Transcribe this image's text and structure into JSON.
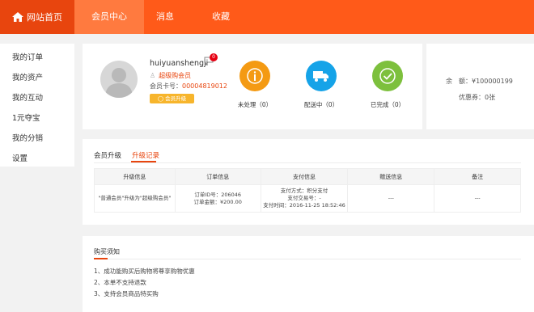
{
  "nav": {
    "home": "网站首页",
    "member_center": "会员中心",
    "messages": "消息",
    "favorites": "收藏"
  },
  "sidebar": {
    "items": [
      {
        "label": "我的订单"
      },
      {
        "label": "我的资产"
      },
      {
        "label": "我的互动"
      },
      {
        "label": "1元夺宝"
      },
      {
        "label": "我的分销"
      },
      {
        "label": "设置"
      }
    ]
  },
  "profile": {
    "username": "huiyuanshengji",
    "message_count": "0",
    "level": "超级购会员",
    "card_label": "会员卡号：",
    "card_no": "00004819012",
    "upgrade_button": "会员升级"
  },
  "stats": [
    {
      "label": "未处理（0）",
      "icon": "info-icon",
      "color": "#f49a13"
    },
    {
      "label": "配送中（0）",
      "icon": "truck-icon",
      "color": "#15a3e8"
    },
    {
      "label": "已完成（0）",
      "icon": "check-icon",
      "color": "#7dc03d"
    }
  ],
  "balance": {
    "balance_label": "余　额：",
    "balance_value": "¥100000199",
    "coupon_label": "优惠券：",
    "coupon_value": "0张"
  },
  "upgrade": {
    "tabs": [
      "会员升级",
      "升级记录"
    ],
    "headers": [
      "升级信息",
      "订单信息",
      "支付信息",
      "赠送信息",
      "备注"
    ],
    "row": {
      "info": "\"普通会员\"升级为\"超级购会员\"",
      "order_id": "订单ID号：206046",
      "order_amount": "订单金额：¥200.00",
      "pay_method": "支付方式：积分支付",
      "pay_no": "支付交易号：-",
      "pay_time": "支付时间：2016-11-25 18:52:46",
      "gift": "---",
      "remark": "---"
    }
  },
  "notice": {
    "title": "购买须知",
    "items": [
      "1、成功能购买后购物将尊享购物优惠",
      "2、本单不支持退款",
      "3、支持会员商品特买购"
    ]
  },
  "colors": {
    "nav_bg": "#ff5a19",
    "accent": "#e8450e"
  }
}
